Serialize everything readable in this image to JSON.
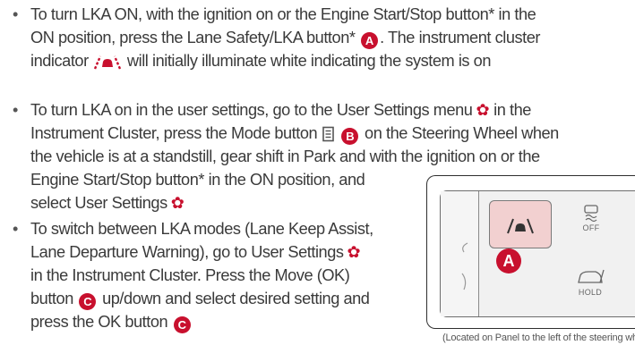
{
  "bullets": [
    {
      "l1": "To turn LKA ON, with the ignition on or the Engine Start/Stop button* in the",
      "l2a": "ON position, press the Lane Safety/LKA button*",
      "l2badge": "A",
      "l2b": ". The instrument cluster",
      "l3a": "indicator",
      "l3b": "will initially illuminate white indicating the system is on"
    },
    {
      "l1a": "To turn LKA on in the user settings, go to the User Settings menu",
      "l1b": "in the",
      "l2a": "Instrument Cluster, press the Mode button",
      "l2badge": "B",
      "l2b": "on the Steering Wheel when",
      "l3": "the vehicle is at a standstill, gear shift in Park and with the ignition on or the",
      "l4": "Engine Start/Stop button* in the ON position, and",
      "l5": "select User Settings"
    },
    {
      "l1": "To switch between LKA modes (Lane Keep Assist,",
      "l2": "Lane Departure Warning), go to User Settings",
      "l3": "in the Instrument Cluster. Press the Move (OK)",
      "l4a": "button",
      "l4badge": "C",
      "l4b": "up/down and select desired setting and",
      "l5": "press the OK button",
      "l5badge": "C"
    }
  ],
  "bullet_glyph": "•",
  "settings_glyph": "✿",
  "figure": {
    "badge": "A",
    "off_label": "OFF",
    "hold_label": "HOLD"
  },
  "caption": "(Located on Panel to the left of the steering wheel)",
  "colors": {
    "accent": "#c8102e",
    "text": "#3a3a3a",
    "lka_button": "#f2d0d0"
  }
}
